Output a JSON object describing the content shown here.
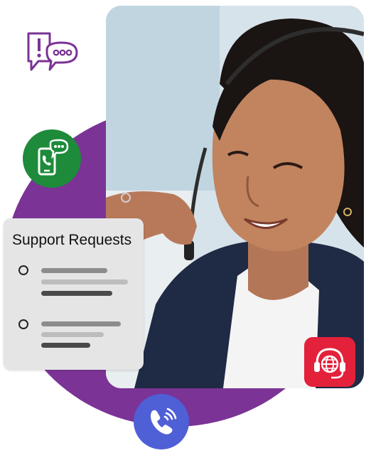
{
  "card": {
    "title": "Support Requests",
    "items": [
      {
        "status": "unselected"
      },
      {
        "status": "unselected"
      }
    ]
  },
  "icons": {
    "chat_alert": "chat-alert-icon",
    "phone_chat": "phone-chat-icon",
    "call": "phone-call-icon",
    "headset": "headset-globe-icon"
  },
  "colors": {
    "purple": "#7b3396",
    "green": "#1d8b3a",
    "blue": "#4f5fd6",
    "red": "#e3213b",
    "card": "#e5e5e6"
  }
}
